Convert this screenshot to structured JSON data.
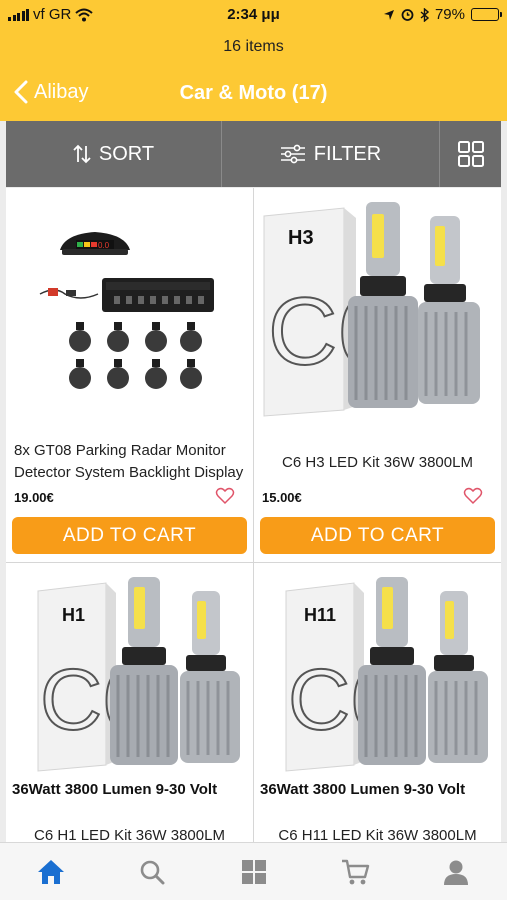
{
  "status_bar": {
    "carrier": "vf GR",
    "time": "2:34 μμ",
    "battery": "79%",
    "battery_level": 0.79
  },
  "header": {
    "items_count": "16 items",
    "back_label": "Alibay",
    "title": "Car & Moto (17)"
  },
  "toolbar": {
    "sort_label": "SORT",
    "filter_label": "FILTER"
  },
  "products": [
    {
      "name": "8x GT08 Parking Radar Monitor Detector System Backlight Display",
      "price": "19.00€",
      "cart_label": "ADD TO CART",
      "image_label": "0.0"
    },
    {
      "name": "C6 H3 LED Kit 36W 3800LM",
      "price": "15.00€",
      "cart_label": "ADD TO CART",
      "box_label": "H3",
      "box_text": "C6"
    },
    {
      "spec": "36Watt 3800 Lumen   9-30 Volt",
      "name": "C6 H1 LED Kit 36W 3800LM",
      "box_label": "H1",
      "box_text": "C6"
    },
    {
      "spec": "36Watt 3800 Lumen   9-30 Volt",
      "name": "C6 H11 LED Kit 36W 3800LM",
      "box_label": "H11",
      "box_text": "C6"
    }
  ],
  "tabbar": {
    "active_color": "#1a6fd1",
    "inactive_color": "#8c8c8c",
    "tabs": [
      "home-icon",
      "search-icon",
      "categories-icon",
      "cart-icon",
      "account-icon"
    ]
  },
  "colors": {
    "header_bg": "#fdc934",
    "toolbar_bg": "#6b6b6b",
    "cart_button": "#f89c18"
  }
}
